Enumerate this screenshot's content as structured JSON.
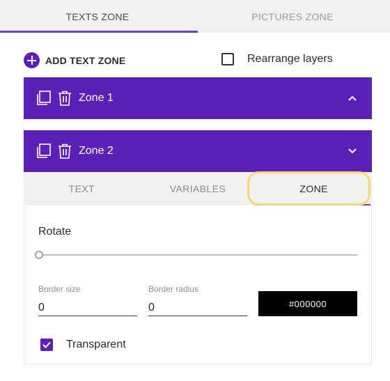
{
  "top_tabs": [
    {
      "label": "TEXTS ZONE",
      "active": true
    },
    {
      "label": "PICTURES ZONE",
      "active": false
    }
  ],
  "toolbar": {
    "add_text_zone_label": "ADD TEXT ZONE",
    "rearrange_label": "Rearrange layers",
    "rearrange_checked": false
  },
  "zones": [
    {
      "title": "Zone 1",
      "expanded": false,
      "chevron": "chevron-up-icon"
    },
    {
      "title": "Zone 2",
      "expanded": true,
      "chevron": "chevron-down-icon"
    }
  ],
  "zone_panel": {
    "tabs": [
      {
        "label": "TEXT",
        "active": false
      },
      {
        "label": "VARIABLES",
        "active": false
      },
      {
        "label": "ZONE",
        "active": true
      }
    ],
    "rotate_label": "Rotate",
    "border_size": {
      "label": "Border size",
      "value": "0"
    },
    "border_radius": {
      "label": "Border radius",
      "value": "0"
    },
    "color_value": "#000000",
    "transparent": {
      "label": "Transparent",
      "checked": true
    }
  },
  "colors": {
    "brand_purple": "#5b21b6",
    "accent_indicator": "#6a3fd0",
    "highlight": "#f7d775"
  }
}
